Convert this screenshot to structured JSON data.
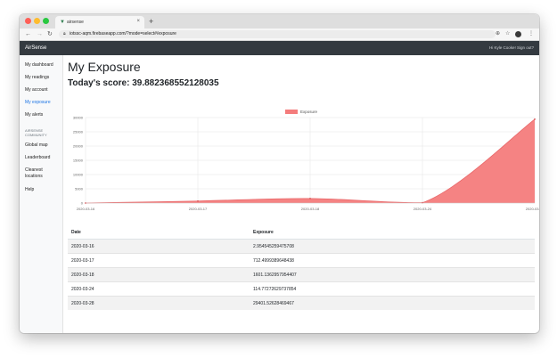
{
  "browser": {
    "tab_title": "airsense",
    "url": "iotssc-aqm.firebaseapp.com/?mode=select#/exposure"
  },
  "app": {
    "brand": "AirSense",
    "greeting": "Hi Kyle Cooke! Sign out?"
  },
  "sidebar": {
    "items": [
      {
        "label": "My dashboard",
        "active": false
      },
      {
        "label": "My readings",
        "active": false
      },
      {
        "label": "My account",
        "active": false
      },
      {
        "label": "My exposure",
        "active": true
      },
      {
        "label": "My alerts",
        "active": false
      }
    ],
    "section_label": "AIRSENSE COMMUNITY",
    "community_items": [
      {
        "label": "Global map"
      },
      {
        "label": "Leaderboard"
      },
      {
        "label": "Cleanest locations"
      },
      {
        "label": "Help"
      }
    ]
  },
  "page": {
    "title": "My Exposure",
    "score": "Today's score: 39.882368552128035"
  },
  "chart_data": {
    "type": "area",
    "categories": [
      "2020-03-16",
      "2020-03-17",
      "2020-03-18",
      "2020-03-24",
      "2020-03-28"
    ],
    "series": [
      {
        "name": "Exposure",
        "values": [
          2.954545259475708,
          712.4999389648438,
          1601.1362957954407,
          114.77272629737854,
          29401.52628469467
        ],
        "color": "#f47c7c"
      }
    ],
    "yticks": [
      "0",
      "5000",
      "10000",
      "15000",
      "20000",
      "25000",
      "30000"
    ],
    "ylim": [
      0,
      30000
    ],
    "legend": "top-center",
    "grid": true
  },
  "table": {
    "columns": [
      "Date",
      "Exposure"
    ],
    "rows": [
      [
        "2020-03-16",
        "2.954545259475708"
      ],
      [
        "2020-03-17",
        "712.4999389648438"
      ],
      [
        "2020-03-18",
        "1601.1362957954407"
      ],
      [
        "2020-03-24",
        "114.77272629737854"
      ],
      [
        "2020-03-28",
        "29401.52628469467"
      ]
    ]
  }
}
